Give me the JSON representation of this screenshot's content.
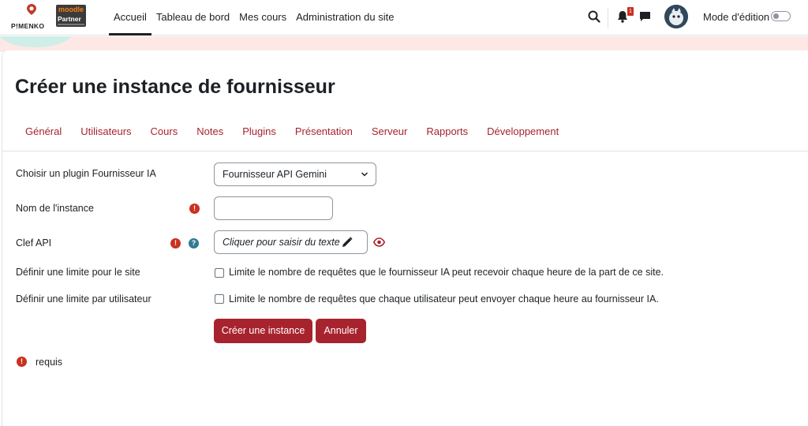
{
  "brand": {
    "pimenko_text": "P!MENKO",
    "moodle_top": "moodle",
    "moodle_bottom": "Partner"
  },
  "nav": {
    "links": [
      "Accueil",
      "Tableau de bord",
      "Mes cours",
      "Administration du site"
    ],
    "active_index": 0,
    "notification_count": "1",
    "edit_mode_label": "Mode d'édition",
    "edit_mode_on": false
  },
  "page": {
    "title": "Créer une instance de fournisseur"
  },
  "tabs": [
    "Général",
    "Utilisateurs",
    "Cours",
    "Notes",
    "Plugins",
    "Présentation",
    "Serveur",
    "Rapports",
    "Développement"
  ],
  "form": {
    "provider_label": "Choisir un plugin Fournisseur IA",
    "provider_value": "Fournisseur API Gemini",
    "instance_name_label": "Nom de l'instance",
    "instance_name_value": "",
    "api_key_label": "Clef API",
    "api_key_placeholder": "Cliquer pour saisir du texte",
    "site_limit_label": "Définir une limite pour le site",
    "site_limit_text": "Limite le nombre de requêtes que le fournisseur IA peut recevoir chaque heure de la part de ce site.",
    "site_limit_checked": false,
    "user_limit_label": "Définir une limite par utilisateur",
    "user_limit_text": "Limite le nombre de requêtes que chaque utilisateur peut envoyer chaque heure au fournisseur IA.",
    "user_limit_checked": false,
    "create_button": "Créer une instance",
    "cancel_button": "Annuler",
    "required_note": "requis"
  },
  "icons": {
    "required": "exclamation-circle-icon",
    "help": "question-circle-icon"
  },
  "colors": {
    "accent": "#a7232d",
    "required": "#ca3120",
    "help": "#2f7c92"
  }
}
